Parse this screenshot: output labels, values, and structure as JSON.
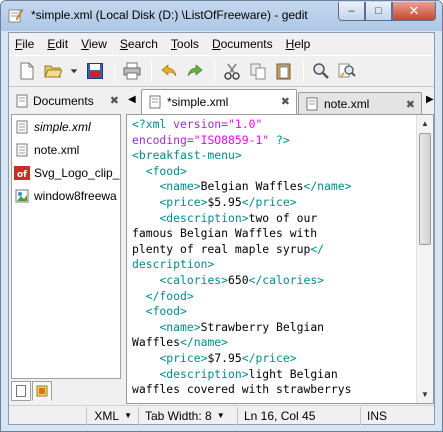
{
  "window": {
    "title": "*simple.xml (Local Disk (D:) \\ListOfFreeware) - gedit",
    "controls": {
      "minimize": "–",
      "maximize": "□",
      "close": "✕"
    }
  },
  "menu": {
    "items": [
      {
        "key": "F",
        "rest": "ile"
      },
      {
        "key": "E",
        "rest": "dit"
      },
      {
        "key": "V",
        "rest": "iew"
      },
      {
        "key": "S",
        "rest": "earch"
      },
      {
        "key": "T",
        "rest": "ools"
      },
      {
        "key": "D",
        "rest": "ocuments"
      },
      {
        "key": "H",
        "rest": "elp"
      }
    ]
  },
  "toolbar": {
    "icons": [
      "new-icon",
      "open-icon",
      "recent-dropdown-icon",
      "save-icon",
      "print-icon",
      "undo-icon",
      "redo-icon",
      "cut-icon",
      "copy-icon",
      "paste-icon",
      "find-icon",
      "replace-icon"
    ]
  },
  "side_panel": {
    "title": "Documents",
    "documents": [
      {
        "label": "simple.xml",
        "icon": "document-icon"
      },
      {
        "label": "note.xml",
        "icon": "document-icon"
      },
      {
        "label": "Svg_Logo_clip_a",
        "icon": "pdf-icon"
      },
      {
        "label": "window8freewa",
        "icon": "image-icon"
      }
    ]
  },
  "tabs": [
    {
      "label": "*simple.xml",
      "active": true
    },
    {
      "label": "note.xml",
      "active": false
    }
  ],
  "editor": {
    "lines": [
      [
        {
          "c": "t",
          "v": "<?xml "
        },
        {
          "c": "a",
          "v": "version="
        },
        {
          "c": "s",
          "v": "\"1.0\""
        }
      ],
      [
        {
          "c": "a",
          "v": "encoding="
        },
        {
          "c": "s",
          "v": "\"ISO8859-1\""
        },
        {
          "c": "t",
          "v": " ?>"
        }
      ],
      [
        {
          "c": "t",
          "v": "<breakfast-menu>"
        }
      ],
      [
        {
          "c": "n",
          "v": "  "
        },
        {
          "c": "t",
          "v": "<food>"
        }
      ],
      [
        {
          "c": "n",
          "v": "    "
        },
        {
          "c": "t",
          "v": "<name>"
        },
        {
          "c": "n",
          "v": "Belgian Waffles"
        },
        {
          "c": "t",
          "v": "</name>"
        }
      ],
      [
        {
          "c": "n",
          "v": "    "
        },
        {
          "c": "t",
          "v": "<price>"
        },
        {
          "c": "n",
          "v": "$5.95"
        },
        {
          "c": "t",
          "v": "</price>"
        }
      ],
      [
        {
          "c": "n",
          "v": "    "
        },
        {
          "c": "t",
          "v": "<description>"
        },
        {
          "c": "n",
          "v": "two of our"
        }
      ],
      [
        {
          "c": "n",
          "v": "famous Belgian Waffles with"
        }
      ],
      [
        {
          "c": "n",
          "v": "plenty of real maple syrup"
        },
        {
          "c": "t",
          "v": "</"
        }
      ],
      [
        {
          "c": "t",
          "v": "description>"
        }
      ],
      [
        {
          "c": "n",
          "v": "    "
        },
        {
          "c": "t",
          "v": "<calories>"
        },
        {
          "c": "n",
          "v": "650"
        },
        {
          "c": "t",
          "v": "</calories>"
        }
      ],
      [
        {
          "c": "n",
          "v": "  "
        },
        {
          "c": "t",
          "v": "</food>"
        }
      ],
      [
        {
          "c": "n",
          "v": "  "
        },
        {
          "c": "t",
          "v": "<food>"
        }
      ],
      [
        {
          "c": "n",
          "v": "    "
        },
        {
          "c": "t",
          "v": "<name>"
        },
        {
          "c": "n",
          "v": "Strawberry Belgian"
        }
      ],
      [
        {
          "c": "n",
          "v": "Waffles"
        },
        {
          "c": "t",
          "v": "</name>"
        }
      ],
      [
        {
          "c": "n",
          "v": "    "
        },
        {
          "c": "t",
          "v": "<price>"
        },
        {
          "c": "n",
          "v": "$7.95"
        },
        {
          "c": "t",
          "v": "</price>"
        }
      ],
      [
        {
          "c": "n",
          "v": "    "
        },
        {
          "c": "t",
          "v": "<description>"
        },
        {
          "c": "n",
          "v": "light Belgian"
        }
      ],
      [
        {
          "c": "n",
          "v": "waffles covered with strawberrys"
        }
      ]
    ],
    "colors": {
      "tag": "#008a8c",
      "attribute": "#9a2fc4",
      "string": "#ff00ff",
      "text": "#000000"
    }
  },
  "status_bar": {
    "language": "XML",
    "tab_width": "Tab Width: 8",
    "position": "Ln 16, Col 45",
    "mode": "INS"
  }
}
